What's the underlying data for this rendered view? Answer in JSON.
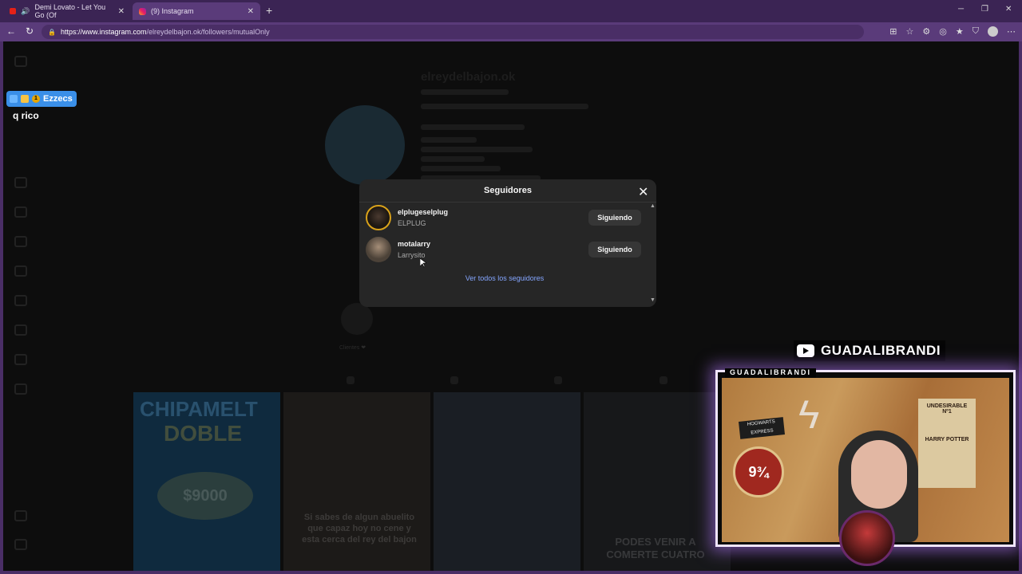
{
  "browser": {
    "tabs": [
      {
        "label": "Demi Lovato - Let You Go (Of",
        "favicon": "youtube-icon",
        "active": false
      },
      {
        "label": "(9) Instagram",
        "favicon": "instagram-icon",
        "active": true
      }
    ],
    "url": {
      "domain": "https://www.instagram.com",
      "path": "/elreydelbajon.ok/followers/mutualOnly"
    }
  },
  "profile_bg": {
    "username": "elreydelbajon.ok"
  },
  "chat": {
    "username": "Ezzecs",
    "badge_num": "1",
    "message": "q rico"
  },
  "modal": {
    "title": "Seguidores",
    "close_icon": "close-icon",
    "followers": [
      {
        "username": "elplugeselplug",
        "name": "ELPLUG",
        "button": "Siguiendo"
      },
      {
        "username": "motalarry",
        "name": "Larrysito",
        "button": "Siguiendo"
      }
    ],
    "see_all": "Ver todos los seguidores"
  },
  "stream": {
    "channel": "GUADALIBRANDI",
    "cam_label": "GUADALIBRANDI"
  },
  "background_tiles": [
    {
      "line1": "CHIPAMELT",
      "line2": "DOBLE",
      "price": "$9000"
    },
    {
      "text": "Si sabes de algun abuelito que capaz hoy no cene y esta cerca del rey del bajon"
    },
    {
      "text": ""
    },
    {
      "text": "PODES VENIR A COMERTE CUATRO"
    }
  ],
  "colors": {
    "tab_bar": "#3b2454",
    "nav_bar": "#5a3b7a",
    "modal_bg": "#262626",
    "link": "#85a6ff",
    "chat_name": "#3a8fe8"
  }
}
